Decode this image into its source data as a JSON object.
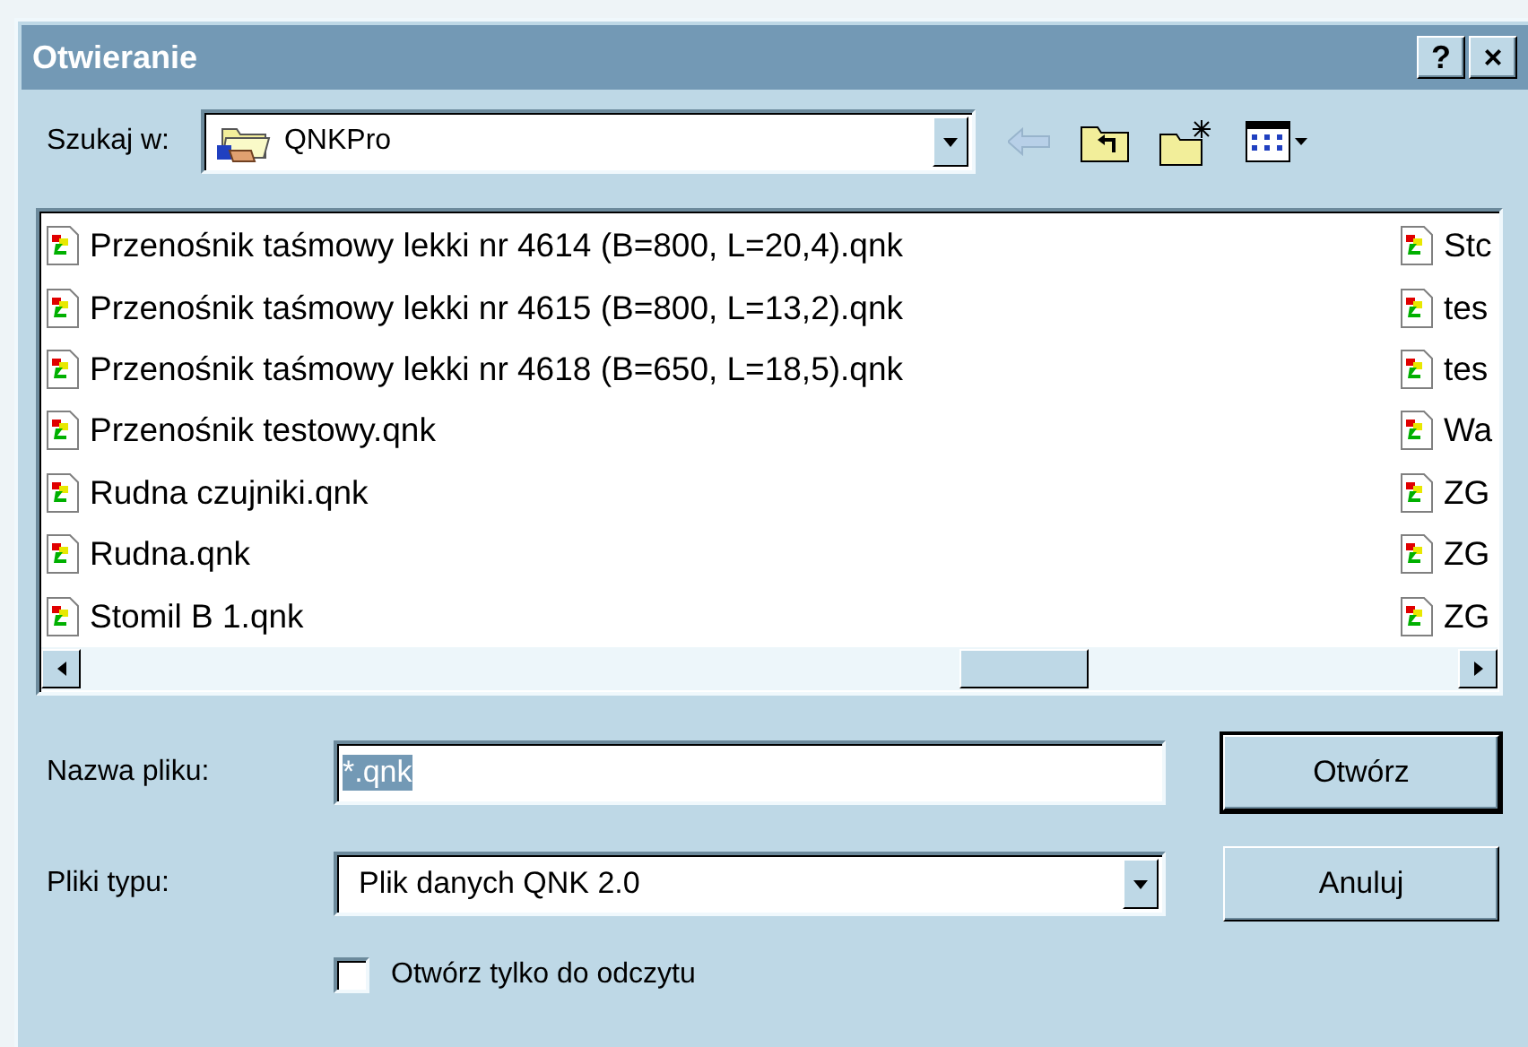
{
  "window": {
    "title": "Otwieranie",
    "title_buttons": [
      "?",
      "×"
    ]
  },
  "look_in": {
    "label": "Szukaj w:",
    "value": "QNKPro"
  },
  "file_list": {
    "columns": [
      {
        "items": [
          "Przenośnik taśmowy lekki nr 4614 (B=800, L=20,4).qnk",
          "Przenośnik taśmowy lekki nr 4615 (B=800, L=13,2).qnk",
          "Przenośnik taśmowy lekki nr 4618 (B=650, L=18,5).qnk",
          "Przenośnik testowy.qnk",
          "Rudna czujniki.qnk",
          "Rudna.qnk",
          "Stomil B 1.qnk"
        ]
      },
      {
        "items": [
          "Stc",
          "tes",
          "tes",
          "Wa",
          "ZG",
          "ZG",
          "ZG"
        ]
      }
    ]
  },
  "file_name": {
    "label": "Nazwa pliku:",
    "value": "*.qnk",
    "selected": true
  },
  "file_type": {
    "label": "Pliki typu:",
    "value": "Plik danych QNK 2.0"
  },
  "buttons": [
    {
      "label": "Otwórz",
      "default": true
    },
    {
      "label": "Anuluj",
      "default": false
    }
  ],
  "read_only": {
    "label": "Otwórz tylko do odczytu",
    "checked": false
  }
}
